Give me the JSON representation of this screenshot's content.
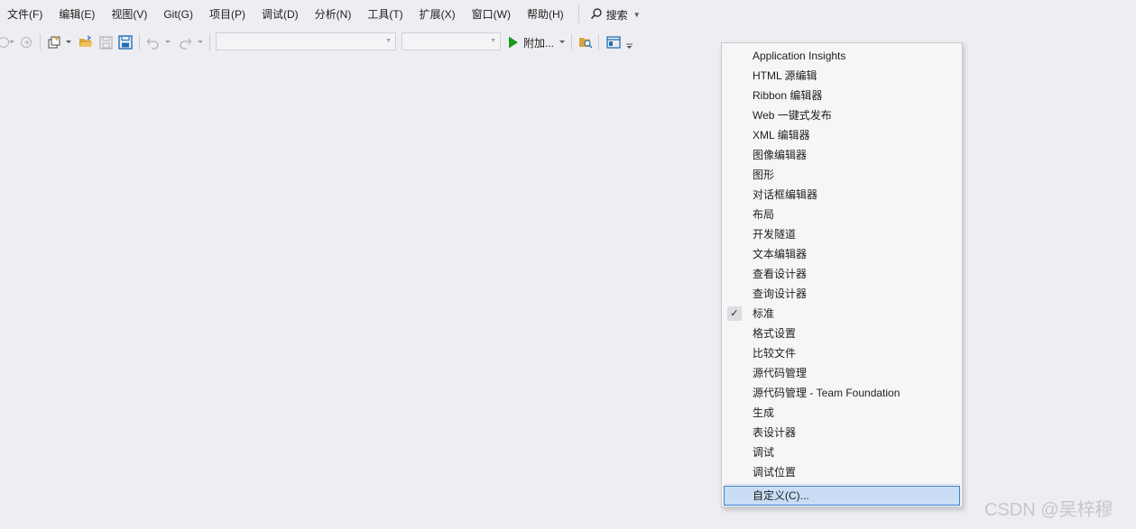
{
  "menubar": {
    "items": [
      "文件(F)",
      "编辑(E)",
      "视图(V)",
      "Git(G)",
      "项目(P)",
      "调试(D)",
      "分析(N)",
      "工具(T)",
      "扩展(X)",
      "窗口(W)",
      "帮助(H)"
    ],
    "search_label": "搜索"
  },
  "toolbar": {
    "run_label": "附加...",
    "icons": [
      "navigate-back-icon",
      "navigate-forward-icon",
      "new-project-icon",
      "open-folder-icon",
      "save-icon",
      "save-all-icon",
      "undo-icon",
      "redo-icon",
      "run-icon",
      "solution-explorer-icon",
      "window-layout-icon",
      "toolbar-options-icon"
    ]
  },
  "toolbar_menu": {
    "items": [
      {
        "label": "Application Insights",
        "checked": false
      },
      {
        "label": "HTML 源编辑",
        "checked": false
      },
      {
        "label": "Ribbon 编辑器",
        "checked": false
      },
      {
        "label": "Web 一键式发布",
        "checked": false
      },
      {
        "label": "XML 编辑器",
        "checked": false
      },
      {
        "label": "图像编辑器",
        "checked": false
      },
      {
        "label": "图形",
        "checked": false
      },
      {
        "label": "对话框编辑器",
        "checked": false
      },
      {
        "label": "布局",
        "checked": false
      },
      {
        "label": "开发隧道",
        "checked": false
      },
      {
        "label": "文本编辑器",
        "checked": false
      },
      {
        "label": "查看设计器",
        "checked": false
      },
      {
        "label": "查询设计器",
        "checked": false
      },
      {
        "label": "标准",
        "checked": true
      },
      {
        "label": "格式设置",
        "checked": false
      },
      {
        "label": "比较文件",
        "checked": false
      },
      {
        "label": "源代码管理",
        "checked": false
      },
      {
        "label": "源代码管理 - Team Foundation",
        "checked": false
      },
      {
        "label": "生成",
        "checked": false
      },
      {
        "label": "表设计器",
        "checked": false
      },
      {
        "label": "调试",
        "checked": false
      },
      {
        "label": "调试位置",
        "checked": false
      }
    ],
    "customize_label": "自定义(C)...",
    "check_glyph": "✓"
  },
  "watermark": "CSDN @吴梓穆",
  "colors": {
    "background": "#eeeef2",
    "menu_background": "#f6f6f7",
    "highlight": "#c9def5",
    "highlight_border": "#3d7fd1",
    "run_green": "#1a9a1a",
    "folder_yellow": "#d9a53c",
    "save_blue": "#1f6fb8"
  }
}
